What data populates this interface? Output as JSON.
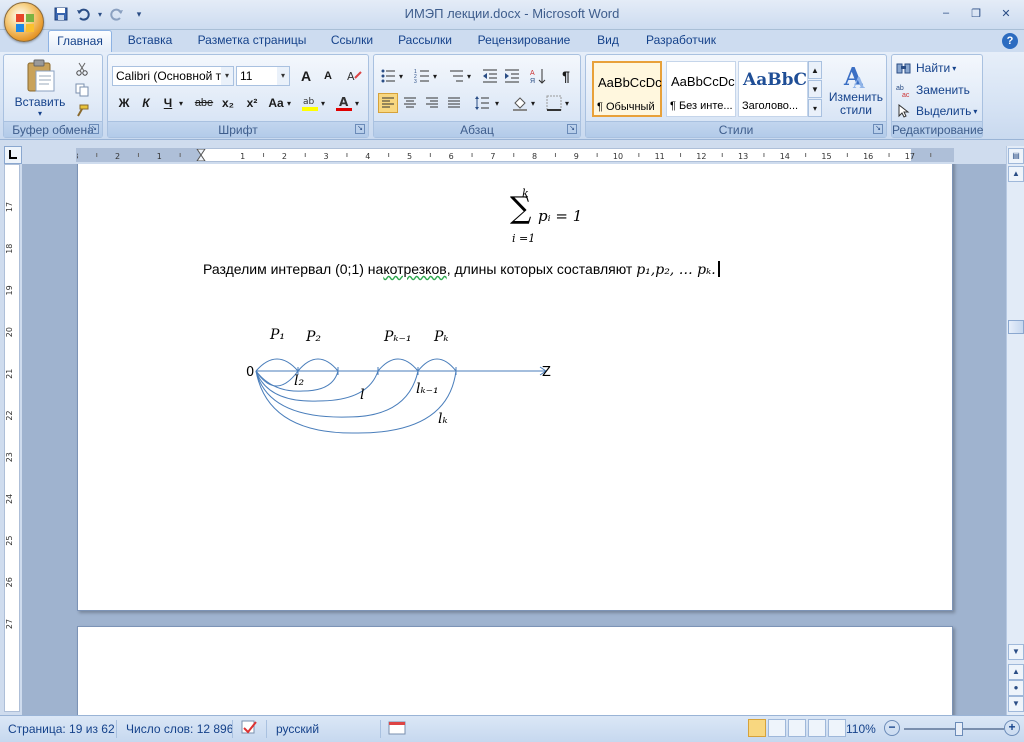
{
  "window": {
    "title": "ИМЭП лекции.docx - Microsoft Word",
    "controls": {
      "minimize": "–",
      "restore": "❐",
      "close": "✕"
    }
  },
  "qat": {
    "save": "💾",
    "undo": "↶",
    "redo": "↷",
    "customize": "▾"
  },
  "tabs": [
    {
      "label": "Главная",
      "active": true
    },
    {
      "label": "Вставка"
    },
    {
      "label": "Разметка страницы"
    },
    {
      "label": "Ссылки"
    },
    {
      "label": "Рассылки"
    },
    {
      "label": "Рецензирование"
    },
    {
      "label": "Вид"
    },
    {
      "label": "Разработчик"
    }
  ],
  "help_label": "?",
  "ribbon": {
    "clipboard": {
      "group_label": "Буфер обмена",
      "paste_label": "Вставить"
    },
    "font": {
      "group_label": "Шрифт",
      "font_name": "Calibri (Основной те",
      "font_size": "11",
      "bold": "Ж",
      "italic": "К",
      "underline": "Ч",
      "strike": "abe",
      "subscript": "x₂",
      "superscript": "x²",
      "case": "Aa",
      "grow": "A",
      "shrink": "A",
      "highlight_color": "#ffff00",
      "font_color": "#e00000"
    },
    "paragraph": {
      "group_label": "Абзац",
      "pilcrow": "¶"
    },
    "styles": {
      "group_label": "Стили",
      "items": [
        {
          "sample": "AaBbCcDc",
          "name": "¶ Обычный",
          "selected": true
        },
        {
          "sample": "AaBbCcDc",
          "name": "¶ Без инте..."
        },
        {
          "sample": "AaBbC",
          "name": "Заголово..."
        }
      ],
      "change_styles_line1": "Изменить",
      "change_styles_line2": "стили"
    },
    "editing": {
      "group_label": "Редактирование",
      "find": "Найти",
      "replace": "Заменить",
      "select": "Выделить"
    }
  },
  "ruler": {
    "h_labels": [
      "3",
      "2",
      "1",
      "1",
      "2",
      "3",
      "4",
      "5",
      "6",
      "7",
      "8",
      "9",
      "10",
      "11",
      "12",
      "13",
      "14",
      "15",
      "16",
      "17"
    ],
    "v_labels": [
      "17",
      "18",
      "19",
      "20",
      "21",
      "22",
      "23",
      "24",
      "25",
      "26",
      "27"
    ]
  },
  "document": {
    "formula": {
      "upper": "k",
      "sigma": "∑",
      "lower": "i =1",
      "body": "pᵢ = 1"
    },
    "paragraph": {
      "text_before": "Разделим интервал (0;1) на",
      "text_spell": "котрезков",
      "text_after": ", длины которых составляют ",
      "math": "p₁,p₂, … pₖ.",
      "spell_error_color": "#2fa84f"
    },
    "diagram": {
      "origin": "0",
      "axis": "Z",
      "top_labels": [
        "P₁",
        "P₂",
        "Pₖ₋₁",
        "Pₖ"
      ],
      "bottom_labels": [
        "l₂",
        "l",
        "lₖ₋₁",
        "lₖ"
      ],
      "line_color": "#4a7ebb"
    }
  },
  "statusbar": {
    "page": "Страница: 19 из 62",
    "words": "Число слов: 12 896",
    "language": "русский",
    "zoom": "110%",
    "zoom_fraction": 0.55
  }
}
